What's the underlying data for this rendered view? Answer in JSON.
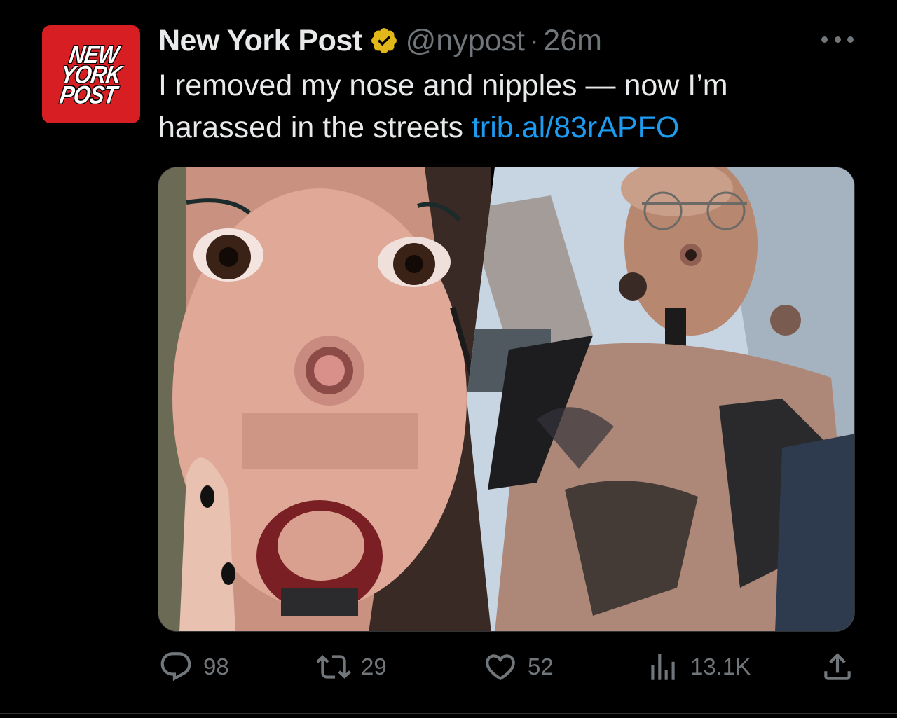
{
  "tweet": {
    "avatar": {
      "logo_text": "NEW\nYORK\nPOST",
      "color": "#d71e23"
    },
    "author": {
      "name": "New York Post",
      "verified_icon": "verified-gold-badge-icon",
      "handle": "@nypost",
      "separator": "·",
      "time": "26m"
    },
    "text": {
      "body": "I removed my nose and nipples — now I’m harassed in the streets ",
      "link": "trib.al/83rAPFO"
    },
    "actions": {
      "reply": {
        "icon": "reply-icon",
        "count": "98"
      },
      "retweet": {
        "icon": "retweet-icon",
        "count": "29"
      },
      "like": {
        "icon": "heart-icon",
        "count": "52"
      },
      "views": {
        "icon": "views-chart-icon",
        "count": "13.1K"
      },
      "share": {
        "icon": "share-icon"
      }
    },
    "colors": {
      "background": "#000000",
      "text": "#e7e9ea",
      "muted": "#71767b",
      "link": "#1d9bf0",
      "verified": "#e2b719"
    }
  }
}
